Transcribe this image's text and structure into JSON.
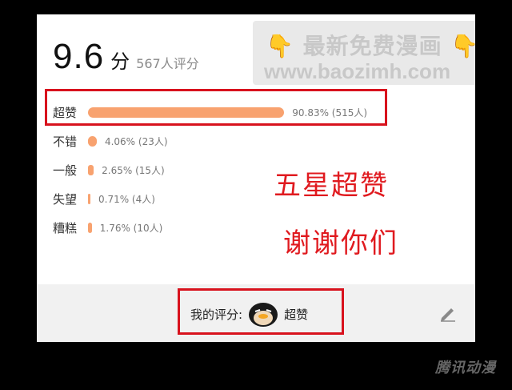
{
  "rating": {
    "score": "9.6",
    "unit": "分",
    "count_text": "567人评分"
  },
  "watermark": {
    "line1": "最新免费漫画",
    "line2": "www.baozimh.com",
    "hand_icon": "👇"
  },
  "distribution": [
    {
      "label": "超赞",
      "percent": 90.83,
      "text": "90.83% (515人)"
    },
    {
      "label": "不错",
      "percent": 4.06,
      "text": "4.06% (23人)"
    },
    {
      "label": "一般",
      "percent": 2.65,
      "text": "2.65% (15人)"
    },
    {
      "label": "失望",
      "percent": 0.71,
      "text": "0.71% (4人)"
    },
    {
      "label": "糟糕",
      "percent": 1.76,
      "text": "1.76% (10人)"
    }
  ],
  "annotation": {
    "line1": "五星超赞",
    "line2": "谢谢你们"
  },
  "my_rating": {
    "label": "我的评分:",
    "value": "超赞"
  },
  "footer": {
    "logo": "腾讯动漫"
  },
  "colors": {
    "bar": "#f8a26f",
    "highlight_box": "#d8121d",
    "annotation_text": "#e01a1f"
  }
}
